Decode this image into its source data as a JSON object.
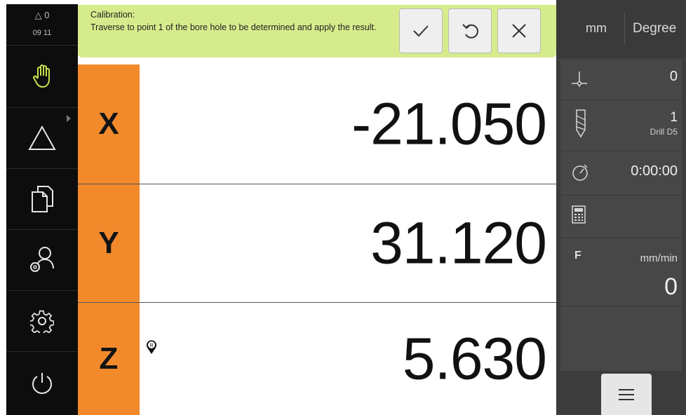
{
  "status": {
    "warning_count": "0",
    "time": "09 11"
  },
  "sidebar": {
    "items": [
      {
        "name": "manual-mode",
        "icon": "hand-icon"
      },
      {
        "name": "mdi-mode",
        "icon": "triangle-icon"
      },
      {
        "name": "files",
        "icon": "documents-icon"
      },
      {
        "name": "user-login",
        "icon": "user-settings-icon"
      },
      {
        "name": "settings",
        "icon": "gear-icon"
      },
      {
        "name": "power",
        "icon": "power-icon"
      }
    ]
  },
  "message": {
    "title": "Calibration:",
    "text": "Traverse to point 1 of the bore hole to be determined and apply the result.",
    "buttons": [
      "confirm-icon",
      "undo-icon",
      "cancel-icon"
    ]
  },
  "axes": [
    {
      "label": "X",
      "value": "-21.050"
    },
    {
      "label": "Y",
      "value": "31.120"
    },
    {
      "label": "Z",
      "value": "5.630"
    }
  ],
  "status_bar": {
    "unit_length": "mm",
    "unit_angle": "Degree",
    "datum_value": "0",
    "tool_number": "1",
    "tool_name": "Drill D5",
    "timer": "0:00:00",
    "feed_label": "F",
    "feed_unit": "mm/min",
    "feed_value": "0"
  },
  "colors": {
    "axis_label": "#f28a2c",
    "message_bg": "#d6ec8c",
    "hand_icon": "#c8e04a"
  }
}
